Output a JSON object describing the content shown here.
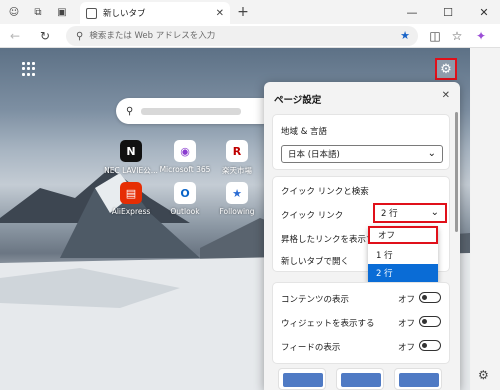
{
  "browser": {
    "tab_title": "新しいタブ",
    "address_placeholder": "検索または Web アドレスを入力"
  },
  "quick_links": [
    {
      "label": "NEC LAVIE公...",
      "icon": "nec-logo-icon"
    },
    {
      "label": "Microsoft 365",
      "icon": "microsoft365-icon"
    },
    {
      "label": "楽天市場",
      "icon": "rakuten-icon"
    },
    {
      "label": "AliExpress",
      "icon": "aliexpress-icon"
    },
    {
      "label": "Outlook",
      "icon": "outlook-icon"
    },
    {
      "label": "Following",
      "icon": "following-icon"
    }
  ],
  "settings": {
    "title": "ページ設定",
    "region_section": "地域 & 言語",
    "region_value": "日本 (日本語)",
    "quicklinks_section": "クイック リンクと検索",
    "quicklinks_label": "クイック リンク",
    "quicklinks_value": "2 行",
    "promoted_label": "昇格したリンクを表示す",
    "newtab_label": "新しいタブで開く",
    "dropdown_options": [
      "オフ",
      "1 行",
      "2 行"
    ],
    "dropdown_selected": "2 行",
    "content_rows": [
      {
        "label": "コンテンツの表示",
        "state": "オフ"
      },
      {
        "label": "ウィジェットを表示する",
        "state": "オフ"
      },
      {
        "label": "フィードの表示",
        "state": "オフ"
      }
    ]
  },
  "colors": {
    "highlight": "#e0101a",
    "selected_option": "#0a6cd6",
    "accent": "#1a64c8"
  }
}
